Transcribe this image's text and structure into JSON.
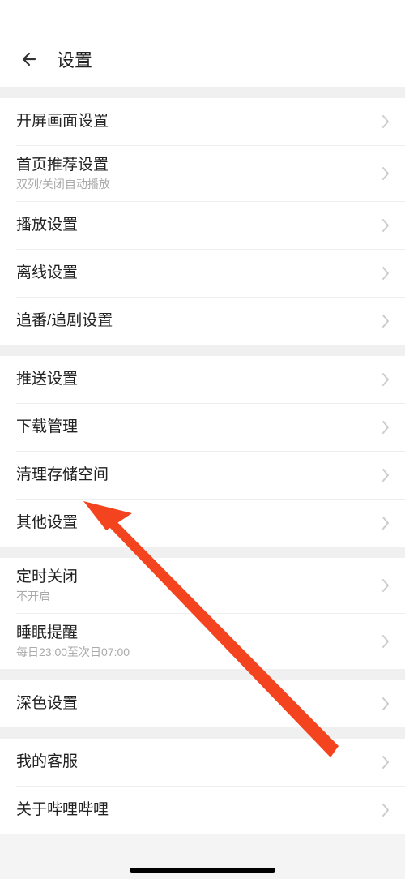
{
  "header": {
    "title": "设置"
  },
  "groups": [
    {
      "items": [
        {
          "name": "splash-settings",
          "title": "开屏画面设置"
        },
        {
          "name": "home-recommend-settings",
          "title": "首页推荐设置",
          "subtitle": "双列/关闭自动播放"
        },
        {
          "name": "playback-settings",
          "title": "播放设置"
        },
        {
          "name": "offline-settings",
          "title": "离线设置"
        },
        {
          "name": "anime-drama-settings",
          "title": "追番/追剧设置"
        }
      ]
    },
    {
      "items": [
        {
          "name": "push-settings",
          "title": "推送设置"
        },
        {
          "name": "download-manager",
          "title": "下载管理"
        },
        {
          "name": "clear-storage",
          "title": "清理存储空间"
        },
        {
          "name": "other-settings",
          "title": "其他设置"
        }
      ]
    },
    {
      "items": [
        {
          "name": "timer-off",
          "title": "定时关闭",
          "subtitle": "不开启"
        },
        {
          "name": "sleep-reminder",
          "title": "睡眠提醒",
          "subtitle": "每日23:00至次日07:00"
        }
      ]
    },
    {
      "items": [
        {
          "name": "dark-mode-settings",
          "title": "深色设置"
        }
      ]
    },
    {
      "items": [
        {
          "name": "my-support",
          "title": "我的客服"
        },
        {
          "name": "about-bilibili",
          "title": "关于哔哩哔哩"
        }
      ]
    }
  ],
  "annotation": {
    "color": "#f3441f"
  }
}
